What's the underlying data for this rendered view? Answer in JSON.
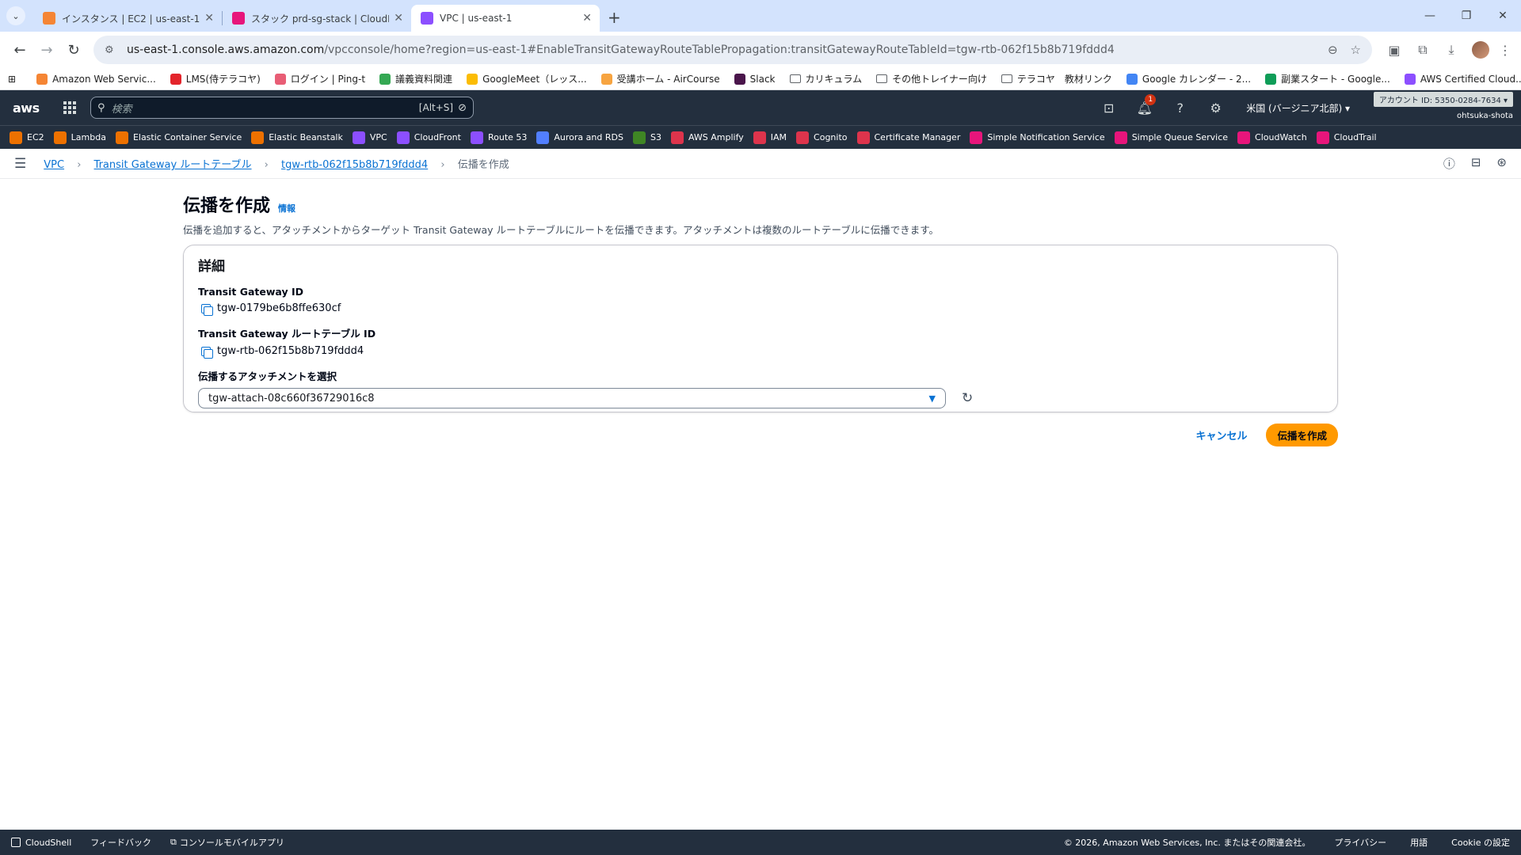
{
  "browser": {
    "tabs": [
      {
        "title": "インスタンス | EC2 | us-east-1",
        "color": "#f58534",
        "active": false
      },
      {
        "title": "スタック prd-sg-stack | CloudFor",
        "color": "#e7157b",
        "active": false
      },
      {
        "title": "VPC | us-east-1",
        "color": "#8c4fff",
        "active": true
      }
    ],
    "url_host": "us-east-1.console.aws.amazon.com",
    "url_path": "/vpcconsole/home?region=us-east-1#EnableTransitGatewayRouteTablePropagation:transitGatewayRouteTableId=tgw-rtb-062f15b8b719fddd4",
    "bookmarks": [
      {
        "label": "Amazon Web Servic...",
        "color": "#f58534",
        "type": "site"
      },
      {
        "label": "LMS(侍テラコヤ)",
        "color": "#e3242b",
        "type": "site"
      },
      {
        "label": "ログイン | Ping-t",
        "color": "#e85d75",
        "type": "site"
      },
      {
        "label": "議義資料関連",
        "color": "#34a853",
        "type": "site"
      },
      {
        "label": "GoogleMeet（レッス...",
        "color": "#fbbc04",
        "type": "site"
      },
      {
        "label": "受講ホーム - AirCourse",
        "color": "#f7a440",
        "type": "site"
      },
      {
        "label": "Slack",
        "color": "#4a154b",
        "type": "site"
      },
      {
        "label": "カリキュラム",
        "color": "",
        "type": "folder"
      },
      {
        "label": "その他トレイナー向け",
        "color": "",
        "type": "folder"
      },
      {
        "label": "テラコヤ　教材リンク",
        "color": "",
        "type": "folder"
      },
      {
        "label": "Google カレンダー - 2...",
        "color": "#4285f4",
        "type": "site"
      },
      {
        "label": "副業スタート - Google...",
        "color": "#0f9d58",
        "type": "site"
      },
      {
        "label": "AWS Certified Cloud...",
        "color": "#8c4fff",
        "type": "site"
      }
    ]
  },
  "aws": {
    "logo": "aws",
    "search_placeholder": "検索",
    "search_shortcut": "[Alt+S]",
    "notification_count": "1",
    "region": "米国 (バージニア北部) ▾",
    "account": "アカウント ID: 5350-0284-7634 ▾",
    "user": "ohtsuka-shota",
    "services": [
      {
        "label": "EC2",
        "color": "#ed7100"
      },
      {
        "label": "Lambda",
        "color": "#ed7100"
      },
      {
        "label": "Elastic Container Service",
        "color": "#ed7100"
      },
      {
        "label": "Elastic Beanstalk",
        "color": "#ed7100"
      },
      {
        "label": "VPC",
        "color": "#8c4fff"
      },
      {
        "label": "CloudFront",
        "color": "#8c4fff"
      },
      {
        "label": "Route 53",
        "color": "#8c4fff"
      },
      {
        "label": "Aurora and RDS",
        "color": "#527fff"
      },
      {
        "label": "S3",
        "color": "#3f8624"
      },
      {
        "label": "AWS Amplify",
        "color": "#dd344c"
      },
      {
        "label": "IAM",
        "color": "#dd344c"
      },
      {
        "label": "Cognito",
        "color": "#dd344c"
      },
      {
        "label": "Certificate Manager",
        "color": "#dd344c"
      },
      {
        "label": "Simple Notification Service",
        "color": "#e7157b"
      },
      {
        "label": "Simple Queue Service",
        "color": "#e7157b"
      },
      {
        "label": "CloudWatch",
        "color": "#e7157b"
      },
      {
        "label": "CloudTrail",
        "color": "#e7157b"
      }
    ]
  },
  "breadcrumb": {
    "items": [
      "VPC",
      "Transit Gateway ルートテーブル",
      "tgw-rtb-062f15b8b719fddd4"
    ],
    "current": "伝播を作成"
  },
  "page": {
    "title": "伝播を作成",
    "info_link": "情報",
    "description": "伝播を追加すると、アタッチメントからターゲット Transit Gateway ルートテーブルにルートを伝播できます。アタッチメントは複数のルートテーブルに伝播できます。",
    "panel_title": "詳細",
    "tgw_label": "Transit Gateway ID",
    "tgw_value": "tgw-0179be6b8ffe630cf",
    "rtb_label": "Transit Gateway ルートテーブル ID",
    "rtb_value": "tgw-rtb-062f15b8b719fddd4",
    "attach_label": "伝播するアタッチメントを選択",
    "attach_value": "tgw-attach-08c660f36729016c8",
    "cancel": "キャンセル",
    "submit": "伝播を作成"
  },
  "footer": {
    "cloudshell": "CloudShell",
    "feedback": "フィードバック",
    "mobile_app": "コンソールモバイルアプリ",
    "copyright": "© 2026, Amazon Web Services, Inc. またはその関連会社。",
    "privacy": "プライバシー",
    "terms": "用語",
    "cookie": "Cookie の設定"
  }
}
